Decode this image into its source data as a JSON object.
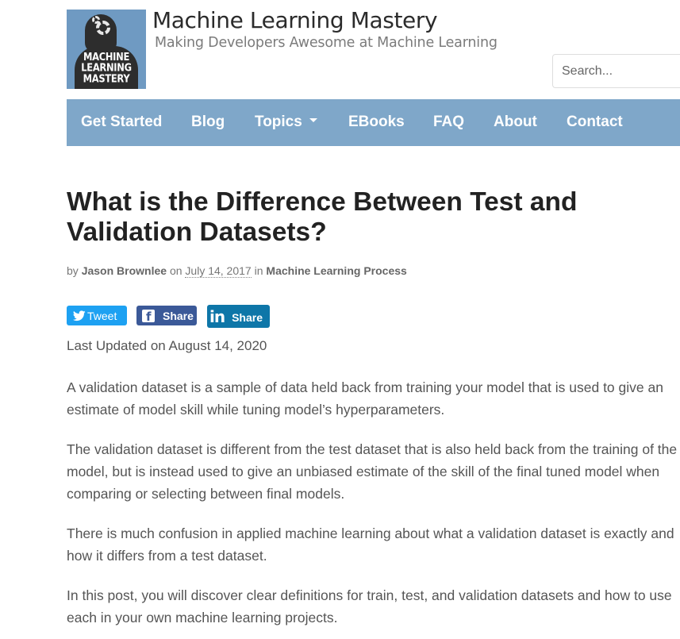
{
  "header": {
    "logo_text": [
      "MACHINE",
      "LEARNING",
      "MASTERY"
    ],
    "site_title": "Machine Learning Mastery",
    "tagline": "Making Developers Awesome at Machine Learning",
    "search_placeholder": "Search..."
  },
  "nav": {
    "items": [
      {
        "label": "Get Started"
      },
      {
        "label": "Blog"
      },
      {
        "label": "Topics",
        "has_dropdown": true
      },
      {
        "label": "EBooks"
      },
      {
        "label": "FAQ"
      },
      {
        "label": "About"
      },
      {
        "label": "Contact"
      }
    ]
  },
  "article": {
    "title": "What is the Difference Between Test and Validation Datasets?",
    "meta": {
      "by": "by",
      "author": "Jason Brownlee",
      "on": "on",
      "date": "July 14, 2017",
      "in": "in",
      "category": "Machine Learning Process"
    },
    "share": {
      "tweet": "Tweet",
      "facebook": "Share",
      "linkedin_icon": "in",
      "linkedin": "Share"
    },
    "updated": "Last Updated on August 14, 2020",
    "paragraphs": [
      "A validation dataset is a sample of data held back from training your model that is used to give an estimate of model skill while tuning model’s hyperparameters.",
      "The validation dataset is different from the test dataset that is also held back from the training of the model, but is instead used to give an unbiased estimate of the skill of the final tuned model when comparing or selecting between final models.",
      "There is much confusion in applied machine learning about what a validation dataset is exactly and how it differs from a test dataset.",
      "In this post, you will discover clear definitions for train, test, and validation datasets and how to use each in your own machine learning projects."
    ]
  },
  "colors": {
    "nav_bg": "#7fa7c9",
    "twitter": "#1da1f2",
    "facebook": "#3b5998",
    "linkedin": "#0e76a8",
    "logo_bg": "#6f9ac2"
  },
  "icons": [
    "gear-icon",
    "twitter-icon",
    "facebook-icon",
    "linkedin-icon",
    "chevron-down-icon"
  ]
}
